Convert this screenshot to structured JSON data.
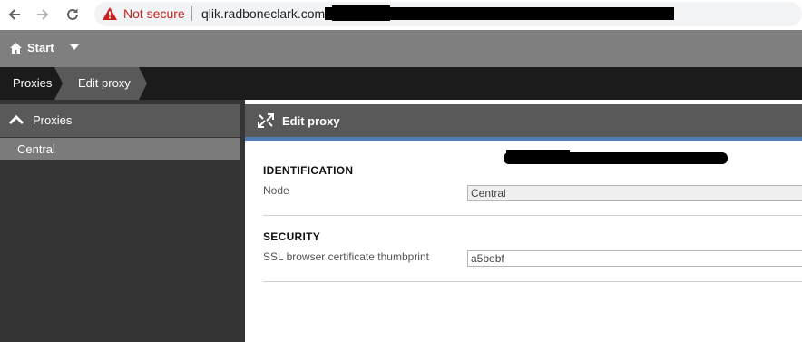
{
  "browser": {
    "security_label": "Not secure",
    "url_visible": "qlik.radboneclark.com",
    "icons": [
      "back-arrow-icon",
      "forward-arrow-icon",
      "reload-icon",
      "warning-icon"
    ]
  },
  "header": {
    "start_label": "Start"
  },
  "breadcrumb": {
    "items": [
      "Proxies",
      "Edit proxy"
    ]
  },
  "sidebar": {
    "title": "Proxies",
    "items": [
      {
        "label": "Central",
        "selected": true
      }
    ]
  },
  "main": {
    "title": "Edit proxy",
    "sections": [
      {
        "title": "IDENTIFICATION",
        "fields": [
          {
            "label": "Node",
            "value": "Central",
            "readonly": true
          }
        ]
      },
      {
        "title": "SECURITY",
        "fields": [
          {
            "label": "SSL browser certificate thumbprint",
            "value": "a5bebf",
            "readonly": false
          }
        ]
      }
    ]
  },
  "colors": {
    "header_bg": "#7f7f7f",
    "breadcrumb_bg": "#1b1b1b",
    "panel_head_bg": "#595959",
    "accent": "#4b7fb3",
    "sidebar_bg": "#353535",
    "selected_item_bg": "#7b7b7b",
    "warning": "#c5221f"
  }
}
